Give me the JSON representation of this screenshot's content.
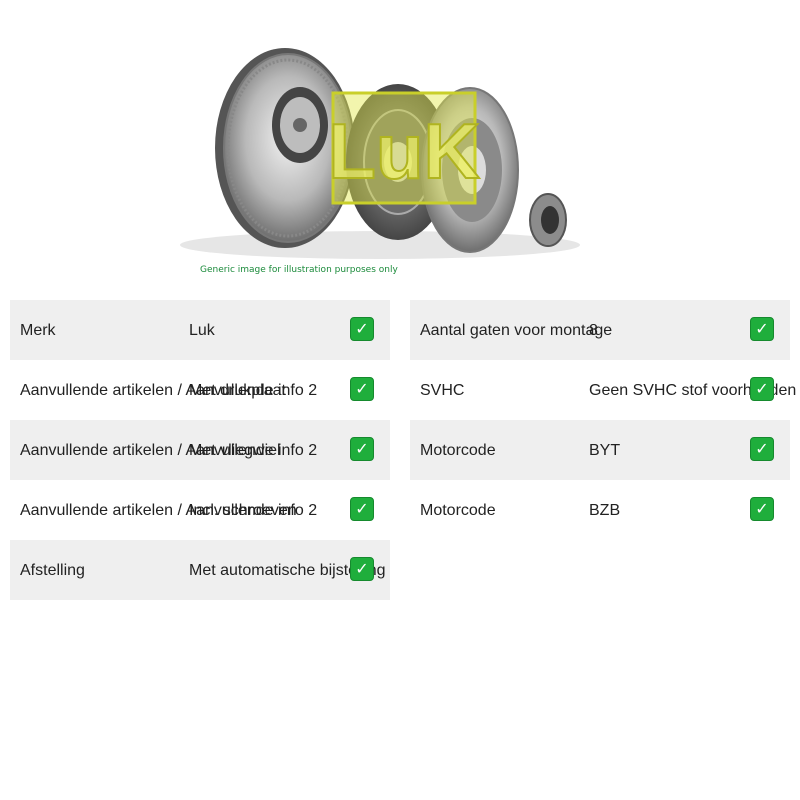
{
  "image": {
    "caption": "Generic image for illustration purposes only",
    "logo_text": "LuK"
  },
  "check_glyph": "✓",
  "specs_left": [
    {
      "key": "Merk",
      "value": "Luk"
    },
    {
      "key": "Aanvullende artikelen / Aanvullende info 2",
      "value": "Met drukplaat"
    },
    {
      "key": "Aanvullende artikelen / Aanvullende info 2",
      "value": "Met vliegwiel"
    },
    {
      "key": "Aanvullende artikelen / Aanvullende info 2",
      "value": "Incl. schroeven"
    },
    {
      "key": "Afstelling",
      "value": "Met automatische bijstelling"
    }
  ],
  "specs_right": [
    {
      "key": "Aantal gaten voor montage",
      "value": "8"
    },
    {
      "key": "SVHC",
      "value": "Geen SVHC stof voorhanden"
    },
    {
      "key": "Motorcode",
      "value": "BYT"
    },
    {
      "key": "Motorcode",
      "value": "BZB"
    }
  ],
  "colors": {
    "check": "#1fae3c",
    "row_shade": "#efefef",
    "caption": "#1a8a3a"
  }
}
